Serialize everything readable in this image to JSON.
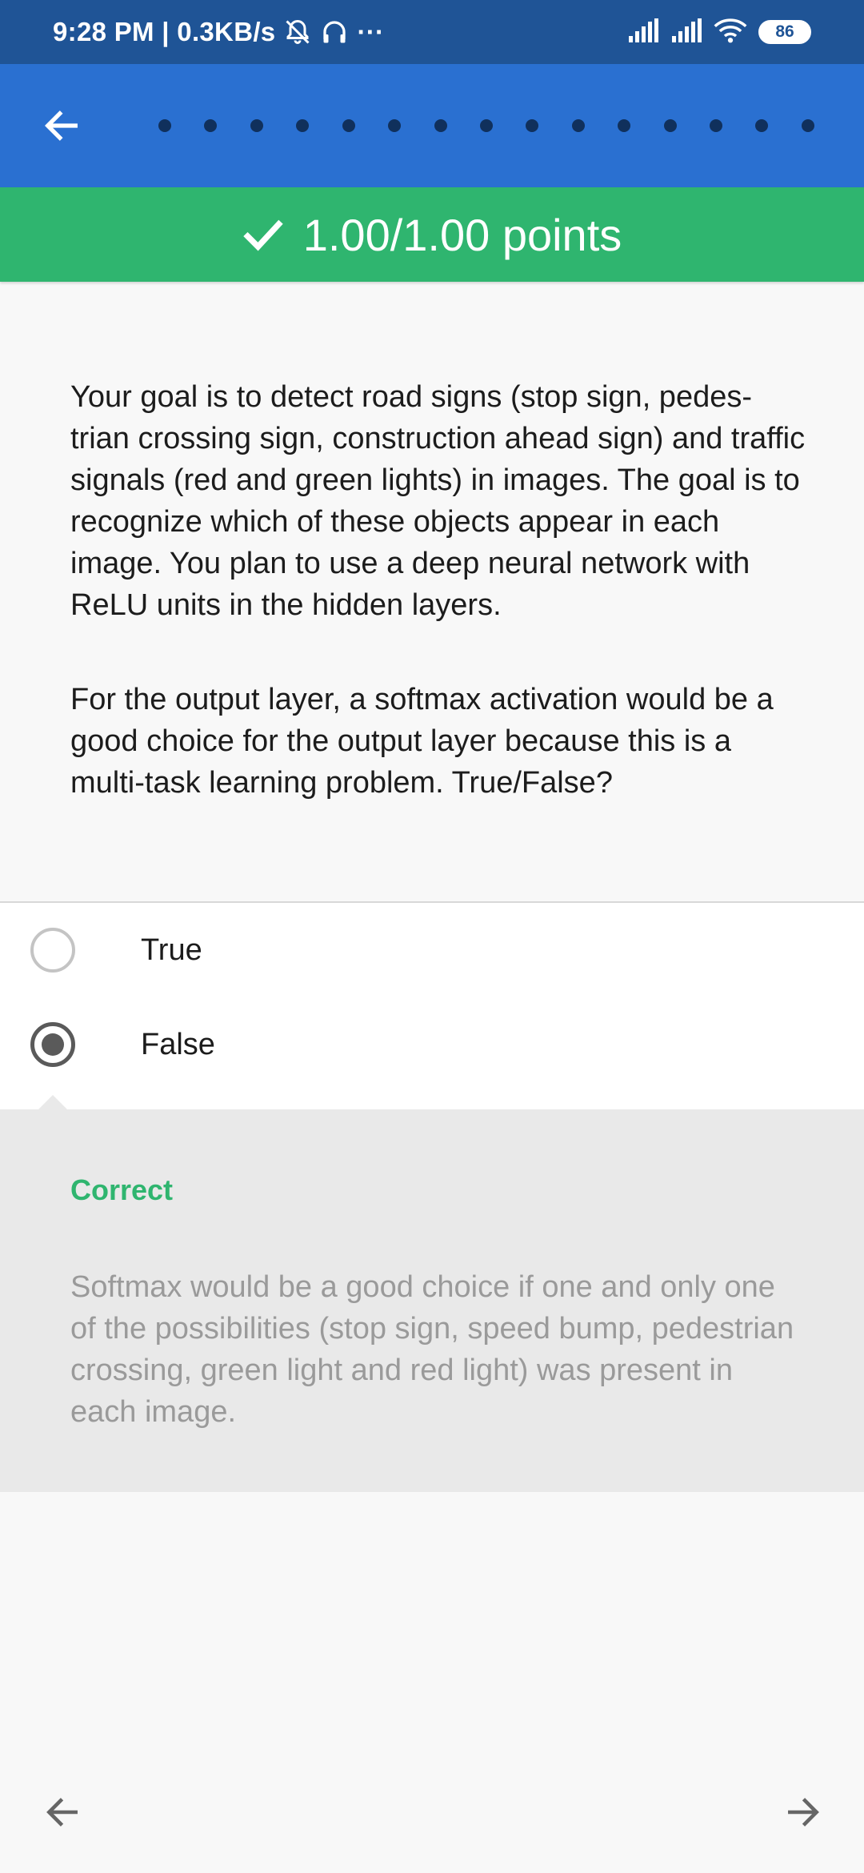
{
  "status_bar": {
    "time_speed": "9:28 PM | 0.3KB/s",
    "more": "···",
    "battery": "86",
    "icons": [
      "mute-alarm-icon",
      "headphones-icon",
      "signal-icon",
      "signal-icon",
      "wifi-icon",
      "battery-icon"
    ]
  },
  "app_bar": {
    "back_icon": "arrow-left-icon",
    "progress_dots": 15
  },
  "score": {
    "icon": "check-icon",
    "text": "1.00/1.00 points"
  },
  "question": {
    "paragraph1": "Your goal is to detect road signs (stop sign, pedes-trian crossing sign, construction ahead sign) and traffic signals (red and green lights) in images. The goal is to recognize which of these objects appear in each image. You plan to use a deep neural network with ReLU units in the hidden layers.",
    "paragraph2": "For the output layer, a softmax activation would be a good choice for the output layer because this is a multi-task learning problem. True/False?"
  },
  "options": [
    {
      "label": "True",
      "selected": false
    },
    {
      "label": "False",
      "selected": true
    }
  ],
  "feedback": {
    "title": "Correct",
    "text": "Softmax would be a good choice if one and only one of the possibilities (stop sign, speed bump, pedestrian crossing, green light and red light) was present in each image."
  },
  "bottom_nav": {
    "prev_icon": "arrow-left-icon",
    "next_icon": "arrow-right-icon"
  },
  "colors": {
    "status_bar": "#1f5496",
    "app_bar": "#2a70d1",
    "dot": "#10305c",
    "success": "#2fb56f",
    "feedback_bg": "#e9e9e9",
    "feedback_text": "#9a9a9a"
  }
}
